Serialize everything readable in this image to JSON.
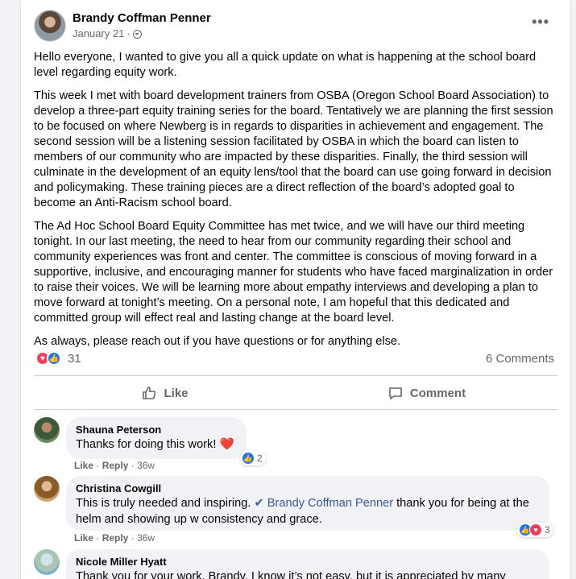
{
  "post": {
    "author": "Brandy Coffman Penner",
    "date": "January 21",
    "separator": "·",
    "more": "•••",
    "paragraphs": [
      "Hello everyone, I wanted to give you all a quick update on what is happening at the school board level regarding equity work.",
      "This week I met with board development trainers from OSBA (Oregon School Board Association) to develop a three-part equity training series for the board. Tentatively we are planning the first session to be focused on where Newberg is in regards to disparities in achievement and engagement. The second session will be a listening session facilitated by OSBA in which the board can listen to members of our community who are impacted by these disparities. Finally, the third session will culminate in the development of an equity lens/tool that the board can use going forward in decision and policymaking. These training pieces are a direct reflection of the board’s adopted goal to become an Anti-Racism school board.",
      "The Ad Hoc School Board Equity Committee has met twice, and we will have our third meeting tonight. In our last meeting, the need to hear from our community regarding their school and community experiences was front and center. The committee is conscious of moving forward in a supportive, inclusive, and encouraging manner for students who have faced marginalization in order to raise their voices. We will be learning more about empathy interviews and developing a plan to move forward at tonight’s meeting. On a personal note, I am hopeful that this dedicated and committed group will effect real and lasting change at the board level.",
      "As always, please reach out if you have questions or for anything else."
    ],
    "reaction_count": "31",
    "comments_count": "6 Comments"
  },
  "actions": {
    "like": "Like",
    "comment": "Comment"
  },
  "comments": [
    {
      "name": "Shauna Peterson",
      "text": "Thanks for doing this work!",
      "emoji": "❤️",
      "like": "Like",
      "reply": "Reply",
      "sep": "·",
      "time": "36w",
      "react_count": "2"
    },
    {
      "name": "Christina Cowgill",
      "text_before": "This is truly needed and inspiring. ",
      "mention": "Brandy Coffman Penner",
      "text_after": " thank you for being at the helm and showing up w consistency and grace.",
      "like": "Like",
      "reply": "Reply",
      "sep": "·",
      "time": "36w",
      "react_count": "3"
    },
    {
      "name": "Nicole Miller Hyatt",
      "text": "Thank you for your work, Brandy. I know it’s not easy, but it is appreciated by many"
    }
  ],
  "colors": {
    "like_blue": "#1877f2",
    "love_red": "#f33e58",
    "mention": "#385898"
  }
}
